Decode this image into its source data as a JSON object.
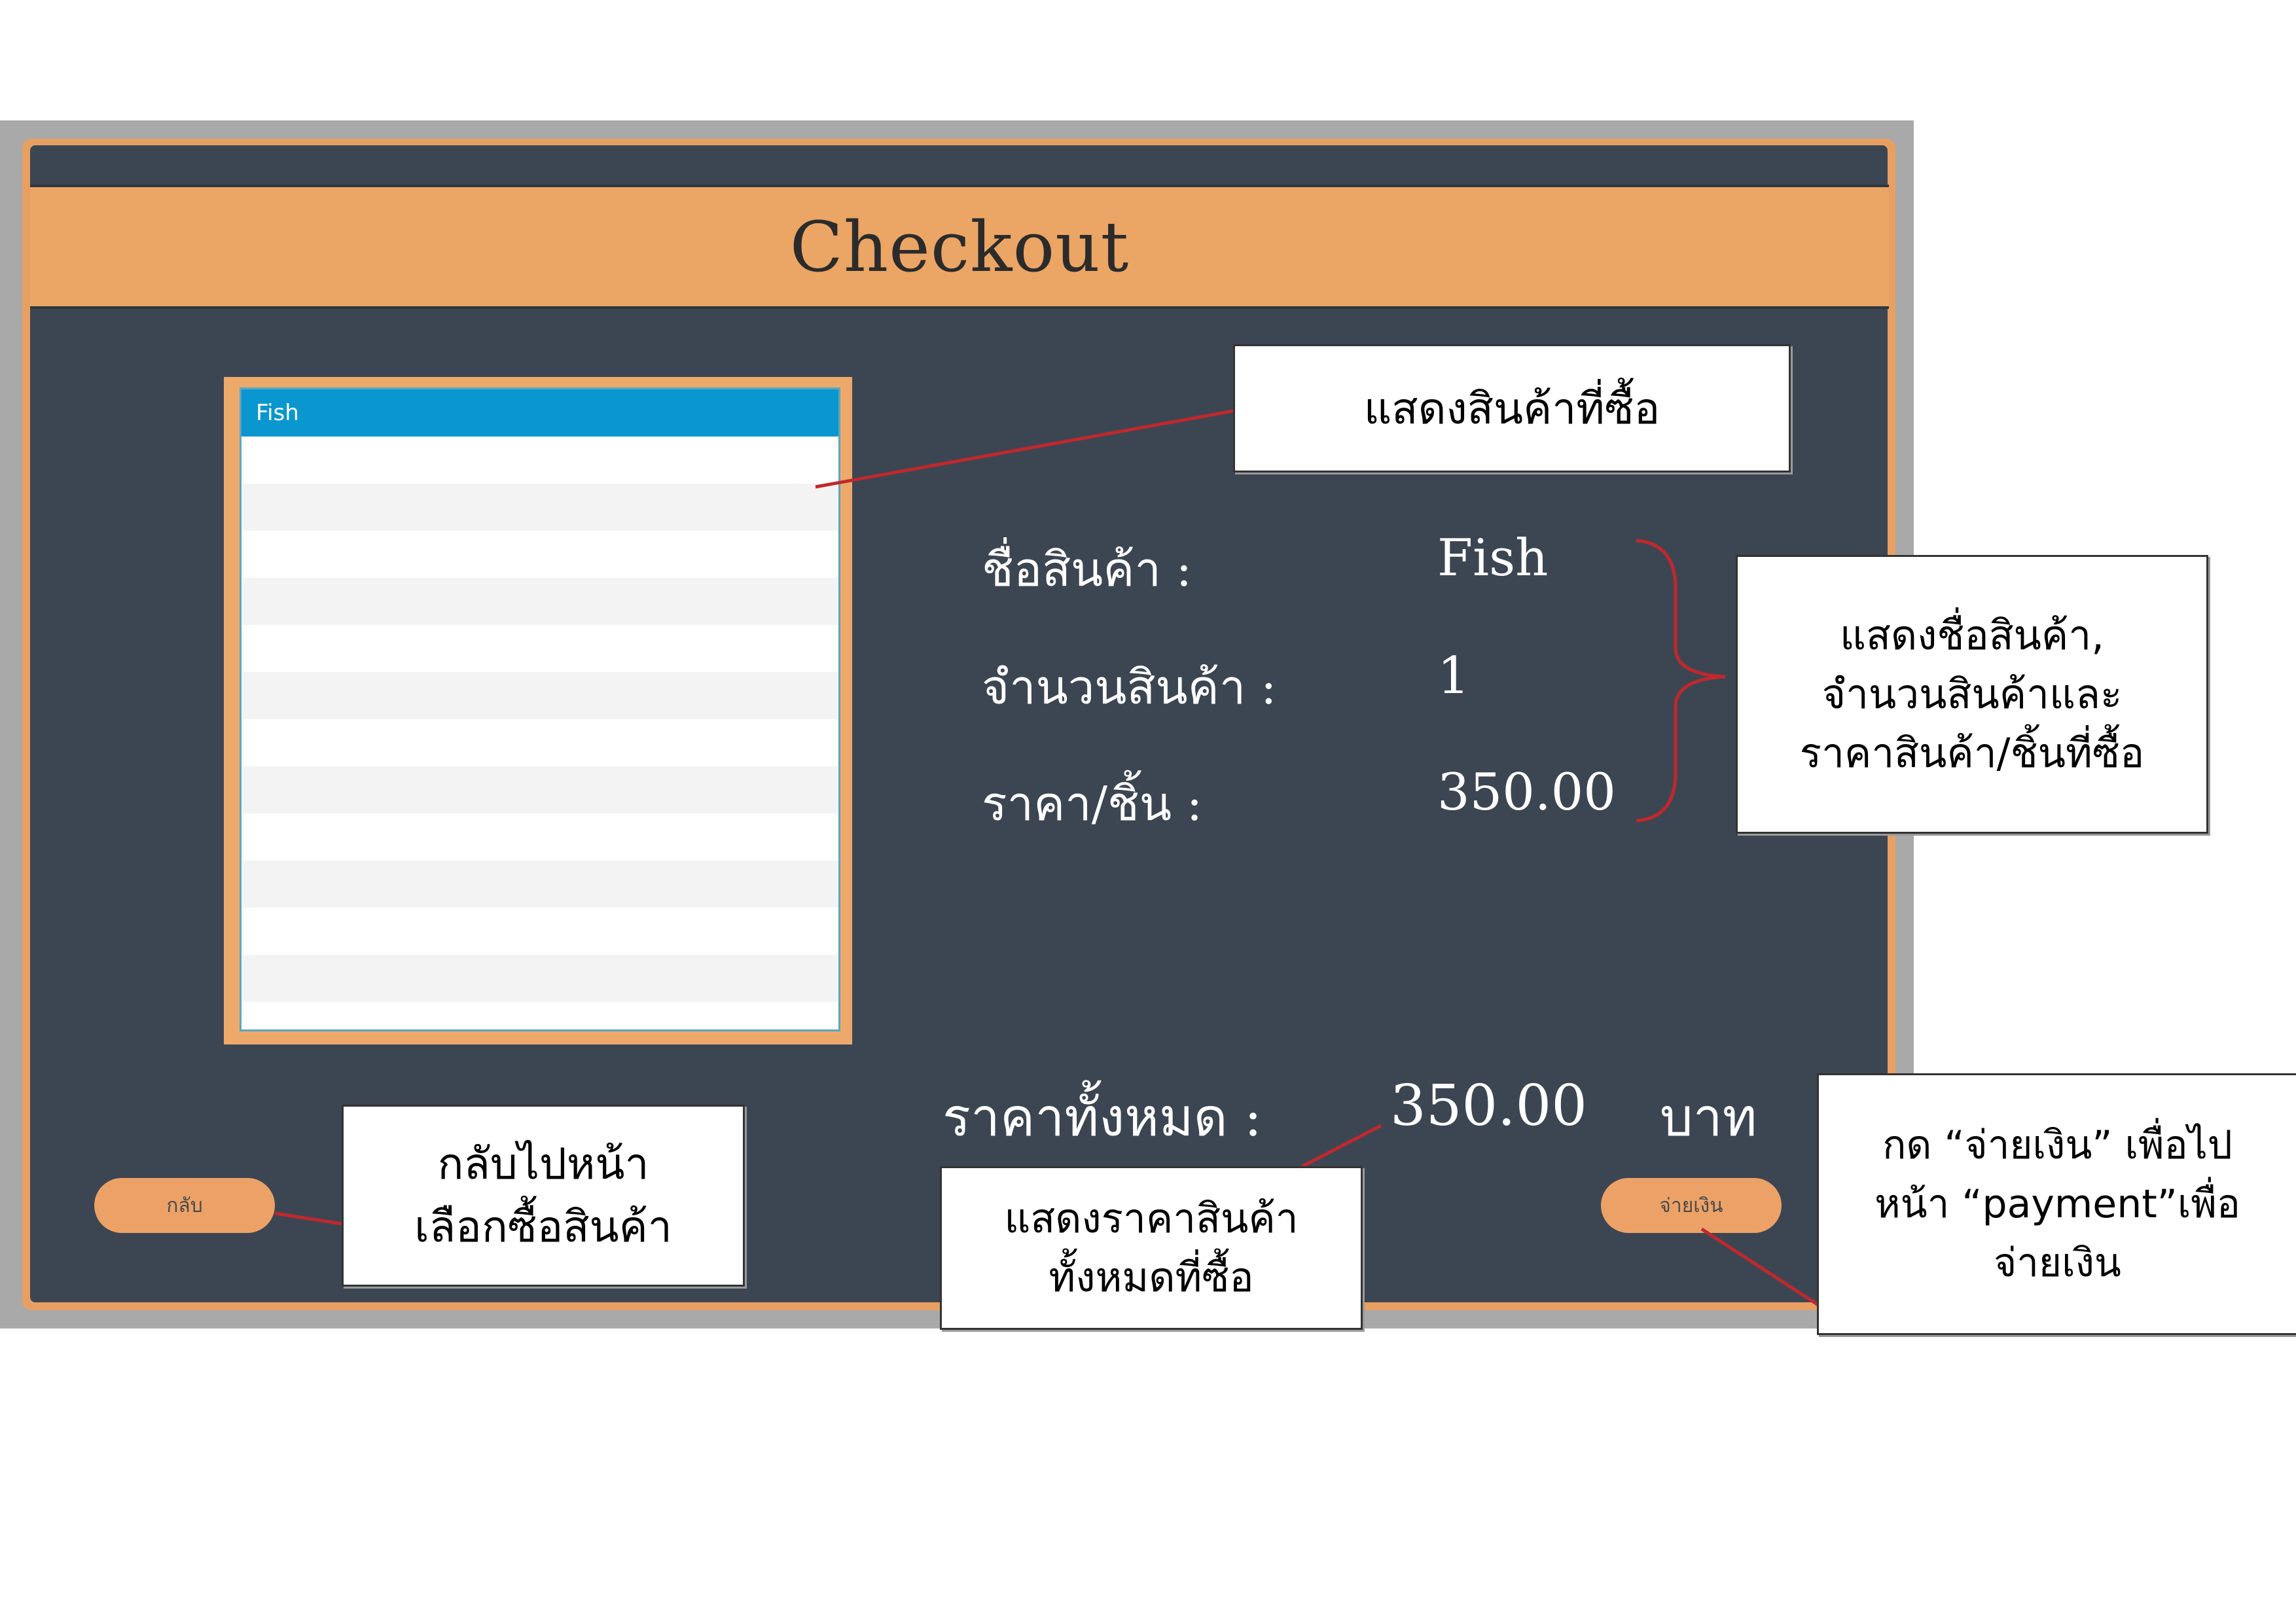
{
  "window": {
    "title": "Checkout"
  },
  "product_list": {
    "selected_item": "Fish"
  },
  "details": {
    "name_label": "ชื่อสินค้า :",
    "name_value": "Fish",
    "qty_label": "จำนวนสินค้า :",
    "qty_value": "1",
    "price_label": "ราคา/ชิ้น :",
    "price_value": "350.00"
  },
  "total": {
    "label": "ราคาทั้งหมด :",
    "value": "350.00",
    "unit": "บาท"
  },
  "buttons": {
    "back": "กลับ",
    "pay": "จ่ายเงิน"
  },
  "annotations": {
    "list_note": "แสดงสินค้าที่ซื้อ",
    "details_note": [
      "แสดงชื่อสินค้า,",
      "จำนวนสินค้าและ",
      "ราคาสินค้า/ชิ้นที่ซื้อ"
    ],
    "back_note": [
      "กลับไปหน้า",
      "เลือกซื้อสินค้า"
    ],
    "total_note": [
      "แสดงราคาสินค้า",
      "ทั้งหมดที่ซื้อ"
    ],
    "pay_note": [
      "กด “จ่ายเงิน” เพื่อไป",
      "หน้า “payment”เพื่อ",
      "จ่ายเงิน"
    ]
  },
  "colors": {
    "window_background": "#3c4652",
    "accent_orange": "#eba565",
    "selection_blue": "#0a96cf",
    "annotation_line": "#c0282d"
  }
}
